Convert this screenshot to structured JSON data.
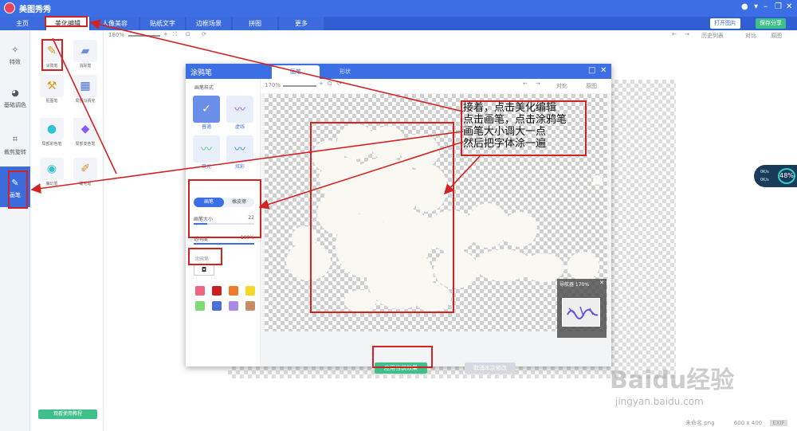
{
  "app": {
    "title": "美图秀秀"
  },
  "nav": {
    "tabs": [
      "主页",
      "美化编辑",
      "人像美容",
      "贴纸文字",
      "边框场景",
      "拼图",
      "更多"
    ],
    "open_image": "打开图片",
    "save_share": "保存分享"
  },
  "left_menu": [
    {
      "label": "特效",
      "icon": "magic-wand-icon"
    },
    {
      "label": "基础调色",
      "icon": "palette-icon"
    },
    {
      "label": "裁剪旋转",
      "icon": "crop-icon"
    },
    {
      "label": "画笔",
      "icon": "brush-icon"
    }
  ],
  "tools": [
    {
      "label": "涂鸦笔",
      "icon": "paintbrush-icon"
    },
    {
      "label": "消除笔",
      "icon": "eraser-icon"
    },
    {
      "label": "抠图笔",
      "icon": "brush-icon"
    },
    {
      "label": "局部马赛克",
      "icon": "mosaic-brush-icon"
    },
    {
      "label": "局部彩色笔",
      "icon": "color-ball-icon"
    },
    {
      "label": "局部变色笔",
      "icon": "color-change-icon"
    },
    {
      "label": "魔幻笔",
      "icon": "magic-pen-icon"
    },
    {
      "label": "睫毛笔",
      "icon": "pencil-icon"
    }
  ],
  "tutorial": "观看使用教程",
  "workspace": {
    "zoom": "180%",
    "history": "历史列表",
    "compare": "对比",
    "original": "原图"
  },
  "status": {
    "filename": "未命名.png",
    "size": "600 x 400",
    "exif": "EXIF"
  },
  "dialog": {
    "title": "涂鸦笔",
    "tabs": [
      "画笔",
      "形状"
    ],
    "brush_style_label": "画笔样式",
    "brushes": [
      "普通",
      "虚线",
      "荧光",
      "炫彩"
    ],
    "modes": [
      "画笔",
      "橡皮擦"
    ],
    "brush_size": {
      "label": "画笔大小",
      "value": "22",
      "fraction": 0.22
    },
    "opacity": {
      "label": "透明度",
      "value": "100%",
      "fraction": 1.0
    },
    "color_label": "涂鸦笔",
    "swatches": [
      "#f06582",
      "#c91f1f",
      "#f07a2a",
      "#f5d92a",
      "#7fdb73",
      "#4a6fd6",
      "#a78be6",
      "#c98a66"
    ],
    "zoom": "170%",
    "compare": "对比",
    "original": "原图",
    "navigator": "导航器 170%",
    "apply": "应用当前效果",
    "cancel": "取消本次修改"
  },
  "annotation": {
    "lines": [
      "接着，点击美化编辑",
      "点击画笔，点击涂鸦笔",
      "画笔大小调大一点",
      "然后把字体涂一遍"
    ]
  },
  "cpu": {
    "percent": "48%",
    "up": "0K/s",
    "down": "0K/s"
  },
  "watermark": {
    "brand": "Baidu经验",
    "url": "jingyan.baidu.com"
  },
  "colors": {
    "accent": "#3c6fe6",
    "annotation": "#d32222",
    "apply": "#3fbf8a"
  }
}
